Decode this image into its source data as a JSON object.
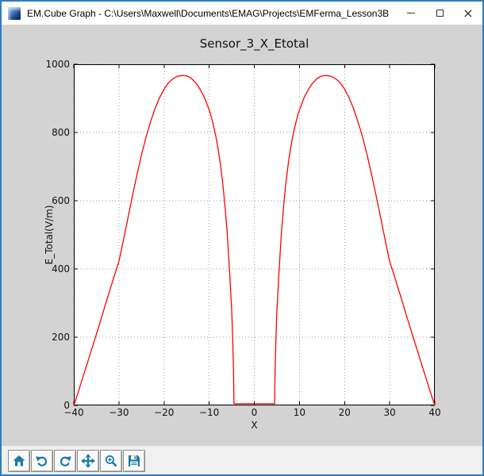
{
  "window": {
    "title": "EM.Cube Graph - C:\\Users\\Maxwell\\Documents\\EMAG\\Projects\\EMFerma_Lesson3B",
    "controls": {
      "minimize": "minimize",
      "maximize": "maximize",
      "close_glyph": "×"
    }
  },
  "colors": {
    "accent": "#2e7cc1",
    "titlebar_bg": "#ffffff",
    "control_glyph": "#333333",
    "figure_bg": "#d3d3d3",
    "axes_bg": "#ffffff",
    "grid": "#9b9b9b",
    "frame": "#000000",
    "toolbar_bg": "#f0f0f0",
    "button_face": "#fafafa",
    "icon": "#1f7aa3",
    "line": "#ff0000"
  },
  "toolbar": {
    "buttons": [
      "home",
      "back",
      "forward",
      "pan",
      "zoom-to-rect",
      "save"
    ]
  },
  "chart_data": {
    "type": "line",
    "title": "Sensor_3_X_Etotal",
    "xlabel": "X",
    "ylabel": "E_Total(V/m)",
    "xlim": [
      -40,
      40
    ],
    "ylim": [
      0,
      1000
    ],
    "xticks": [
      -40,
      -30,
      -20,
      -10,
      0,
      10,
      20,
      30,
      40
    ],
    "yticks": [
      0,
      200,
      400,
      600,
      800,
      1000
    ],
    "grid": true,
    "grid_style": "dotted",
    "line_color": "#ff0000",
    "series": [
      {
        "name": "E_Total",
        "x": [
          -40,
          -39,
          -38,
          -37,
          -36,
          -35,
          -34,
          -33,
          -32,
          -31,
          -30,
          -29,
          -28,
          -27,
          -26,
          -25,
          -24,
          -23,
          -22,
          -21,
          -20,
          -19,
          -18,
          -17,
          -16,
          -15,
          -14,
          -13,
          -12,
          -11,
          -10,
          -9.5,
          -9,
          -8.5,
          -8,
          -7.5,
          -7,
          -6.5,
          -6,
          -5.5,
          -5,
          -4.8,
          -4.6,
          -4.5,
          4.5,
          4.6,
          4.8,
          5,
          5.5,
          6,
          6.5,
          7,
          7.5,
          8,
          8.5,
          9,
          9.5,
          10,
          11,
          12,
          13,
          14,
          15,
          16,
          17,
          18,
          19,
          20,
          21,
          22,
          23,
          24,
          25,
          26,
          27,
          28,
          29,
          30,
          31,
          32,
          33,
          34,
          35,
          36,
          37,
          38,
          39,
          40
        ],
        "y": [
          0,
          40,
          82,
          124,
          166,
          208,
          251,
          295,
          338,
          381,
          422,
          485,
          550,
          614,
          676,
          734,
          786,
          831,
          870,
          902,
          927,
          946,
          958,
          965,
          967,
          966,
          959,
          946,
          927,
          901,
          866,
          844,
          818,
          787,
          750,
          706,
          652,
          586,
          504,
          398,
          275,
          200,
          105,
          5,
          5,
          105,
          200,
          275,
          398,
          504,
          586,
          652,
          706,
          750,
          787,
          818,
          844,
          866,
          901,
          927,
          946,
          959,
          966,
          967,
          965,
          958,
          946,
          927,
          902,
          870,
          831,
          786,
          734,
          676,
          614,
          550,
          485,
          422,
          381,
          338,
          295,
          251,
          208,
          166,
          124,
          82,
          40,
          0
        ]
      }
    ]
  }
}
